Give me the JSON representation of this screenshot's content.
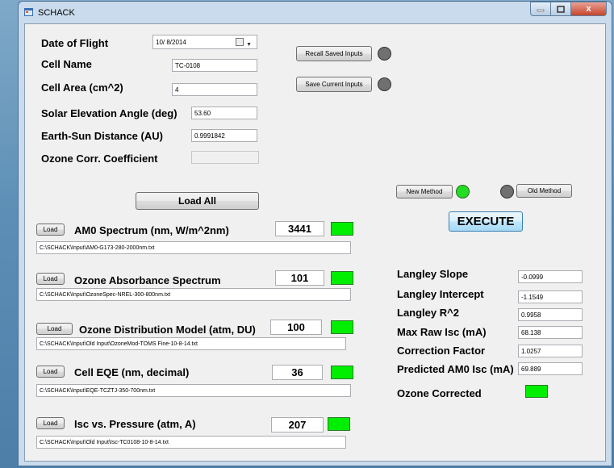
{
  "window": {
    "title": "SCHACK",
    "close_glyph": "x"
  },
  "inputs": {
    "date_label": "Date of Flight",
    "date_value": "10/ 8/2014",
    "cell_name_label": "Cell Name",
    "cell_name_value": "TC-0108",
    "cell_area_label": "Cell Area (cm^2)",
    "cell_area_value": "4",
    "solar_elev_label": "Solar Elevation Angle (deg)",
    "solar_elev_value": "53.60",
    "earth_sun_label": "Earth-Sun Distance (AU)",
    "earth_sun_value": "0.9991842",
    "ozone_coeff_label": "Ozone Corr. Coefficient",
    "ozone_coeff_value": ""
  },
  "buttons": {
    "recall": "Recall Saved Inputs",
    "save": "Save Current Inputs",
    "load_all": "Load All",
    "new_method": "New Method",
    "old_method": "Old Method",
    "execute": "EXECUTE",
    "load": "Load"
  },
  "files": [
    {
      "label": "AM0 Spectrum (nm, W/m^2nm)",
      "count": "3441",
      "path": "C:\\SCHACK\\Input\\AM0-G173-280-2000nm.txt"
    },
    {
      "label": "Ozone Absorbance Spectrum",
      "count": "101",
      "path": "C:\\SCHACK\\Input\\OzoneSpec-NREL-300-800nm.txt"
    },
    {
      "label": "Ozone Distribution Model (atm, DU)",
      "count": "100",
      "path": "C:\\SCHACK\\Input\\Old Input\\OzoneMod-TOMS Fine-10-8-14.txt"
    },
    {
      "label": "Cell EQE (nm, decimal)",
      "count": "36",
      "path": "C:\\SCHACK\\Input\\EQE-TCZTJ-350-700nm.txt"
    },
    {
      "label": "Isc vs. Pressure (atm, A)",
      "count": "207",
      "path": "C:\\SCHACK\\Input\\Old Input\\Isc-TC0108-10-8-14.txt"
    }
  ],
  "results": [
    {
      "label": "Langley Slope",
      "value": "-0.0999"
    },
    {
      "label": "Langley Intercept",
      "value": "-1.1549"
    },
    {
      "label": "Langley R^2",
      "value": "0.9958"
    },
    {
      "label": "Max Raw Isc (mA)",
      "value": "68.138"
    },
    {
      "label": "Correction Factor",
      "value": "1.0257"
    },
    {
      "label": "Predicted AM0 Isc (mA)",
      "value": "69.889"
    }
  ],
  "ozone_corrected_label": "Ozone Corrected",
  "colors": {
    "status_green": "#00ee00",
    "indicator_gray": "#707070",
    "indicator_green": "#22dd22"
  }
}
